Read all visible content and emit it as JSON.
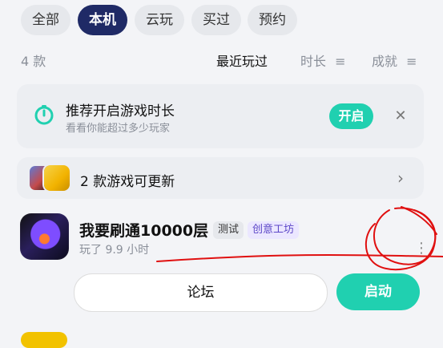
{
  "filters": [
    "全部",
    "本机",
    "云玩",
    "买过",
    "预约"
  ],
  "filter_active": "本机",
  "list": {
    "count_text": "4 款",
    "sort": [
      "最近玩过",
      "时长",
      "成就"
    ],
    "sort_active": "最近玩过"
  },
  "promo": {
    "title": "推荐开启游戏时长",
    "subtitle": "看看你能超过多少玩家",
    "enable_label": "开启",
    "close_icon": "close-icon"
  },
  "updates": {
    "text": "2 款游戏可更新",
    "chevron_icon": "chevron-right-icon"
  },
  "game": {
    "name": "我要刷通10000层",
    "tags": [
      "测试",
      "创意工坊"
    ],
    "played": "玩了 9.9 小时",
    "forum_label": "论坛",
    "launch_label": "启动",
    "more_icon": "more-vertical-icon"
  },
  "colors": {
    "accent": "#20d0b0",
    "active_chip": "#1f2a66",
    "annotation": "#e01010"
  }
}
